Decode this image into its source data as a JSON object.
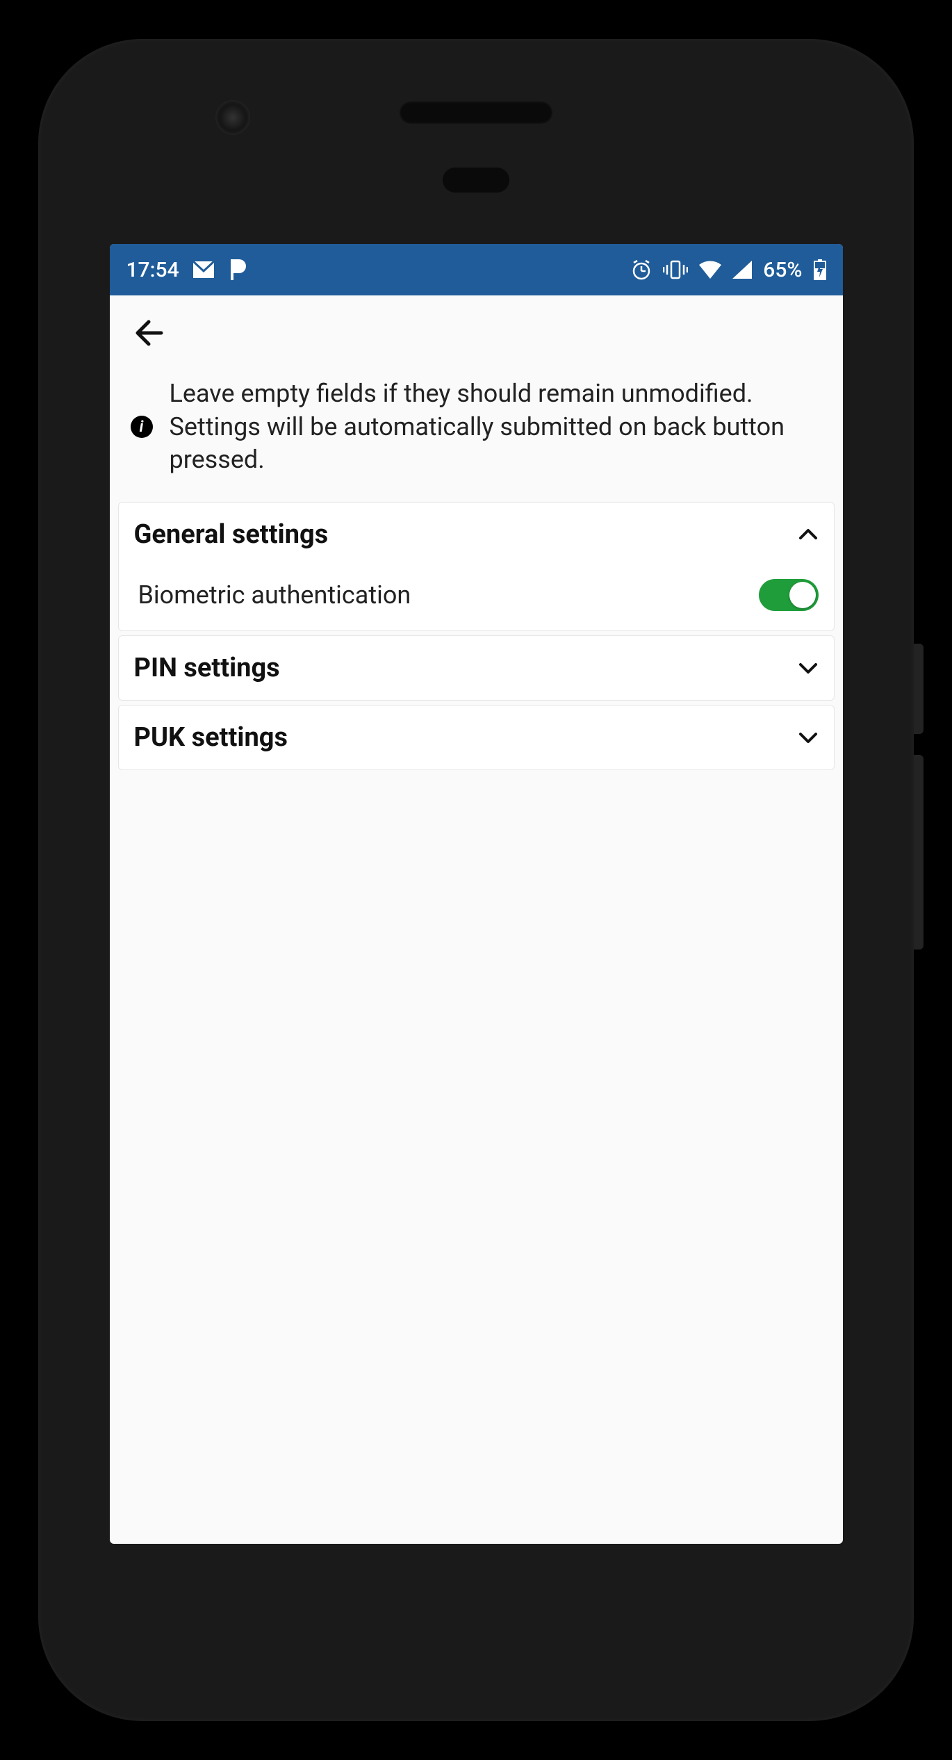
{
  "status_bar": {
    "time": "17:54",
    "battery_percent": "65%"
  },
  "info": {
    "text": "Leave empty fields if they should remain unmodified. Settings will be automatically submitted on back button pressed."
  },
  "sections": {
    "general": {
      "title": "General settings",
      "expanded": true,
      "items": {
        "biometric": {
          "label": "Biometric authentication",
          "value": true
        }
      }
    },
    "pin": {
      "title": "PIN settings",
      "expanded": false
    },
    "puk": {
      "title": "PUK settings",
      "expanded": false
    }
  }
}
